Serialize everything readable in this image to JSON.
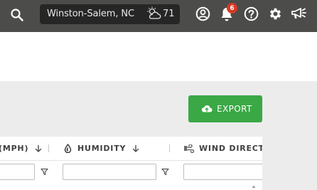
{
  "topbar": {
    "location": "Winston-Salem, NC",
    "temperature": "71",
    "notification_count": "6",
    "icons": [
      "search-icon",
      "partly-cloudy-icon",
      "user-icon",
      "bell-icon",
      "help-icon",
      "gear-icon",
      "megaphone-icon"
    ]
  },
  "toolbar": {
    "export_label": "EXPORT",
    "export_color": "#3aa845"
  },
  "grid": {
    "columns": [
      {
        "label": "(MPH)",
        "icon": "",
        "sort_icon": "arrow-down-icon"
      },
      {
        "label": "HUMIDITY",
        "icon": "droplet-icon",
        "sort_icon": "arrow-down-icon"
      },
      {
        "label": "WIND DIRECTIO",
        "icon": "wind-icon",
        "sort_icon": ""
      }
    ],
    "filters": [
      "",
      "",
      ""
    ]
  }
}
